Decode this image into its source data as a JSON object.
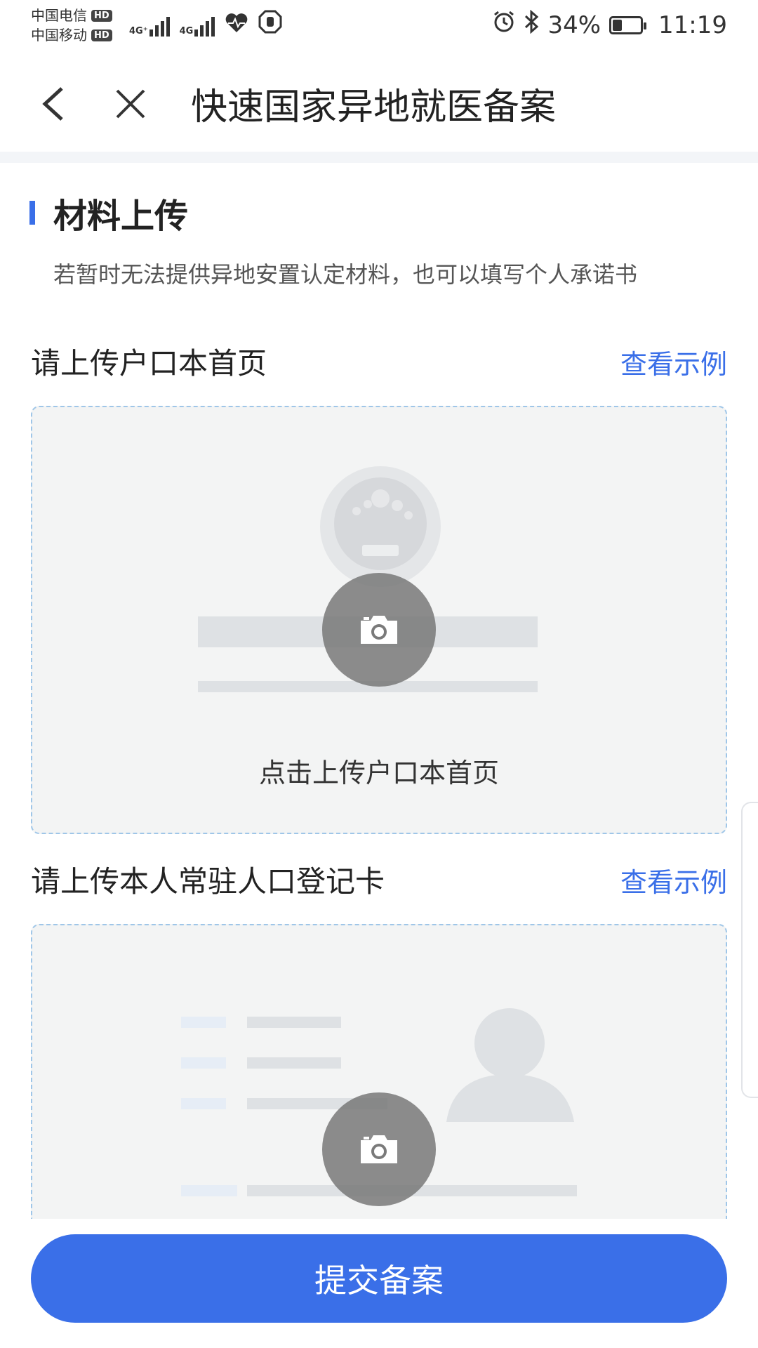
{
  "status_bar": {
    "carrier1": "中国电信",
    "carrier2": "中国移动",
    "hd_badge": "HD",
    "net1": "4G⁺",
    "net2": "4G",
    "battery_percent": "34%",
    "battery_level": 0.34,
    "time": "11:19",
    "icons": [
      "signal-icon",
      "heart-rate-icon",
      "hand-stop-icon",
      "alarm-icon",
      "bluetooth-icon",
      "battery-icon"
    ]
  },
  "header": {
    "title": "快速国家异地就医备案",
    "icons": [
      "back-arrow-icon",
      "close-icon"
    ]
  },
  "section": {
    "title": "材料上传",
    "hint": "若暂时无法提供异地安置认定材料，也可以填写个人承诺书"
  },
  "uploads": [
    {
      "label": "请上传户口本首页",
      "example_link": "查看示例",
      "caption": "点击上传户口本首页"
    },
    {
      "label": "请上传本人常驻人口登记卡",
      "example_link": "查看示例"
    }
  ],
  "submit": {
    "label": "提交备案"
  },
  "colors": {
    "accent": "#3a6fe8",
    "dashed_border": "#9fc6e8",
    "upload_bg": "#f3f4f4",
    "camera_circle": "#7a7a7a"
  }
}
